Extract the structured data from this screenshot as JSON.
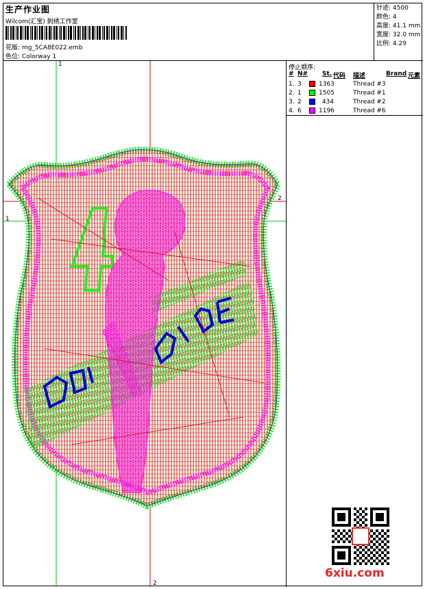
{
  "header": {
    "title": "生产作业图",
    "company": "Wilcom(汇宝) 刺绣工作室",
    "design_label": "花版:",
    "design_file": "mg_5CA8E022.emb",
    "colorway_label": "色位:",
    "colorway": "Colorway 1"
  },
  "stats": [
    {
      "label": "针迹:",
      "value": "4500"
    },
    {
      "label": "颜色:",
      "value": "4"
    },
    {
      "label": "高度:",
      "value": "41.1 mm"
    },
    {
      "label": "宽度:",
      "value": "32.0 mm"
    },
    {
      "label": "比例:",
      "value": "4.29"
    }
  ],
  "stop_sequence": {
    "title": "停止顺序:",
    "headers": {
      "num": "#",
      "n": "N#",
      "st": "St.",
      "code": "代码",
      "desc": "描述",
      "brand": "Brand",
      "element": "元素"
    },
    "rows": [
      {
        "num": "1.",
        "n": "3",
        "color": "#ff0000",
        "st": "1363",
        "desc": "Thread #3"
      },
      {
        "num": "2.",
        "n": "1",
        "color": "#00ff00",
        "st": "1505",
        "desc": "Thread #1"
      },
      {
        "num": "3.",
        "n": "2",
        "color": "#0000ff",
        "st": "434",
        "desc": "Thread #2"
      },
      {
        "num": "4.",
        "n": "6",
        "color": "#ff00ff",
        "st": "1196",
        "desc": "Thread #6"
      }
    ]
  },
  "axis_markers": {
    "top": "1",
    "left": "1",
    "right": "2",
    "bottom": "2"
  },
  "logo": "6xiu.com",
  "colors": {
    "red": "#e0001a",
    "green": "#22ee22",
    "blue": "#0000cc",
    "magenta": "#ff22ee",
    "guide_green": "#00cc00",
    "guide_red": "#dd0000"
  }
}
